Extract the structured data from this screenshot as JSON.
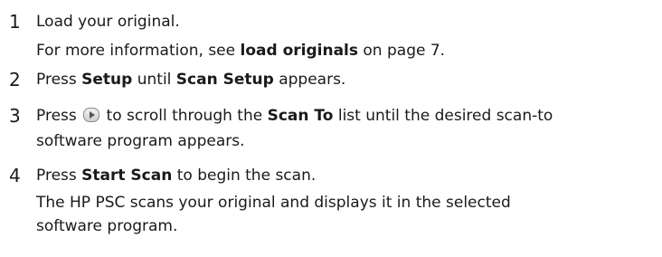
{
  "steps": [
    {
      "number": "1",
      "line1": "Load your original.",
      "line2_prefix": "For more information, see ",
      "line2_bold": "load originals",
      "line2_suffix": " on page 7."
    },
    {
      "number": "2",
      "prefix": "Press ",
      "bold1": "Setup",
      "middle": " until ",
      "bold2": "Scan Setup",
      "suffix": " appears."
    },
    {
      "number": "3",
      "prefix": "Press ",
      "icon": "scroll-right-button-icon",
      "middle": " to scroll through the ",
      "bold": "Scan To",
      "suffix": " list until the desired scan-to",
      "line2": "software program appears."
    },
    {
      "number": "4",
      "prefix": "Press ",
      "bold": "Start Scan",
      "suffix": " to begin the scan.",
      "line2": "The HP PSC scans your original and displays it in the selected",
      "line3": "software program."
    }
  ]
}
